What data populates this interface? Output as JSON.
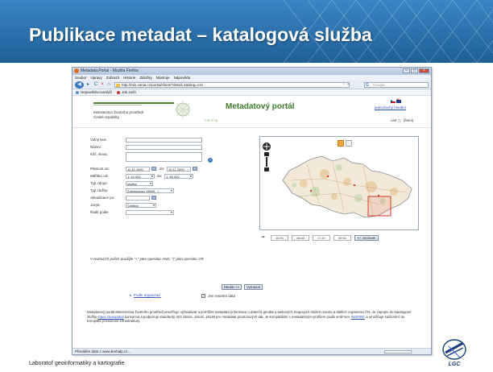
{
  "slide": {
    "title": "Publikace metadat – katalogová služba",
    "footer": "Laboratoř geoinformatiky a kartografie",
    "logo_text": "LGC"
  },
  "browser": {
    "window_title": "Metadata Portal - Mozilla Firefox",
    "menu": [
      "Soubor",
      "Úpravy",
      "Zobrazit",
      "Historie",
      "Záložky",
      "Nástroje",
      "Nápověda"
    ],
    "url": "http://mis.cenia.cz/portal/client/?detail=1&lang=cze",
    "search_placeholder": "Google",
    "bookmarks": [
      "Nejnavštěvovanější",
      "Jak začít"
    ],
    "status": "Přenáším data z www.brehalp.cz..."
  },
  "portal": {
    "ministry_line1": "Ministerstvo životního prostředí",
    "ministry_line2": "České republiky",
    "cenia": "cenia",
    "title": "Metadatový portál",
    "simple_search": "jednoduchý hledání",
    "cart": "cart",
    "cart_suffix": "(čtení)",
    "form": {
      "free_text_label": "Volný text:",
      "name_label": "Název:",
      "keywords_label": "Klíč. slova:",
      "validity_label": "Platnost od:",
      "validity_from": "10.11.2000",
      "validity_to_label": "do:",
      "validity_to": "10.11.2000",
      "scale_label": "Měřítko od:",
      "scale_from": "1: 10 000",
      "scale_to_label": "do:",
      "scale_to": "1: 50 000",
      "resource_type_label": "Typ zdroje:",
      "resource_type": "služba",
      "service_type_label": "Typ služby:",
      "service_type": "Zobrazovací (WMS...)",
      "updated_label": "Aktualizace po:",
      "language_label": "Jazyk:",
      "language": "Čeština",
      "sort_label": "Řadit podle"
    },
    "note": "V textových polích použijte \"+\" jako operátor AND, \"|\" jako operátor OR",
    "coords": [
      "15.91",
      "48.63",
      "17.47",
      "49.51"
    ],
    "zoom_button": "<< Seznam",
    "search_button": "Hledat >>",
    "clear_button": "Vymazat",
    "org_link": "Podle organizací",
    "resort_checkbox": "Jen resortní data",
    "description_1": "Metadatový portál Ministerstva životního prostředí umožňuje vyhledávat a prohlížet metadata (informace o datech) geodat a webových mapových služeb resortu a dalších organizací ČR. Je zapojen do katalogové služby ",
    "description_link_1": "Open Geospatial",
    "description_2": " konsorcia a podporuje standardy ISO 19115, 19119, 19139 pro metadata prostorových dat. Je kompatibilní s metadatovým profilem podle směrnice ",
    "description_link_2": "INSPIRE",
    "description_3": " a umožňuje začlenění do Evropské prostorové infrastruktury."
  },
  "colors": {
    "slide_header": "#2a6fae",
    "portal_green": "#3f7a2c",
    "selection_red": "#d43a2a"
  }
}
